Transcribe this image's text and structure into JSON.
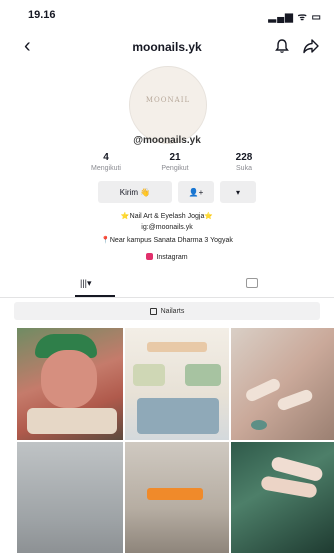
{
  "status": {
    "time": "19.16",
    "icons": "▂▄▆ ᯤ ▭"
  },
  "header": {
    "title": "moonails.yk"
  },
  "profile": {
    "avatar_text": "MOONAIL",
    "handle": "@moonails.yk",
    "stats": [
      {
        "value": "4",
        "label": "Mengikuti"
      },
      {
        "value": "21",
        "label": "Pengikut"
      },
      {
        "value": "228",
        "label": "Suka"
      }
    ],
    "buttons": {
      "message": "Kirim 👋",
      "add_friend": "👤+",
      "more": "▾"
    },
    "bio": [
      "⭐Nail Art & Eyelash Jogja⭐",
      "ig:@moonails.yk",
      "📍Near kampus Sanata Dharma 3 Yogyak"
    ],
    "instagram": "Instagram"
  },
  "tabs": {
    "grid": "|||▾"
  },
  "playlist": {
    "label": "Nailarts"
  },
  "icons": {
    "back": "back-icon",
    "bell": "bell-icon",
    "share": "share-icon",
    "grid": "grid-icon",
    "repost": "repost-icon",
    "playlist": "playlist-icon"
  },
  "colors": {
    "accent": "#fe2c55",
    "instagram": "#e1306c",
    "button_bg": "#eeeeef"
  }
}
